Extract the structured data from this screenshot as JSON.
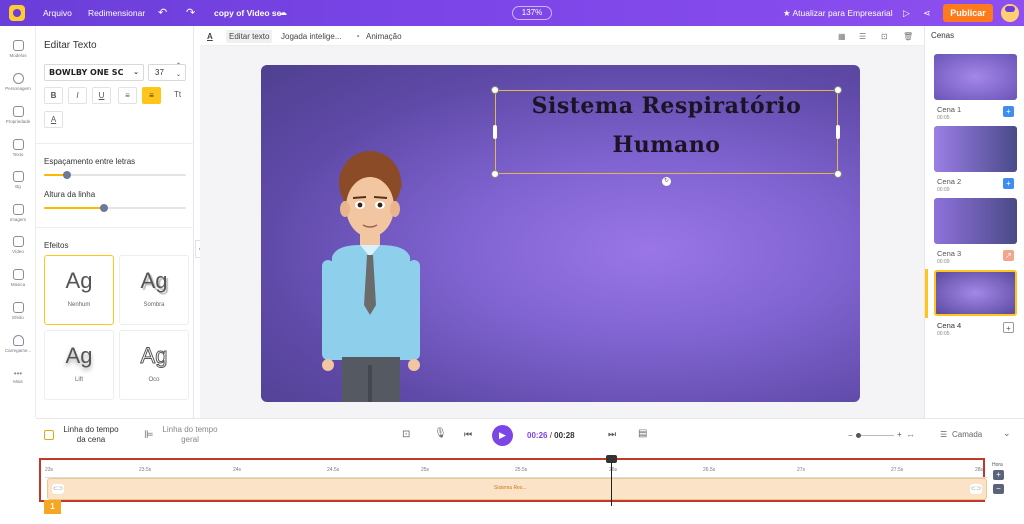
{
  "header": {
    "menu_arquivo": "Arquivo",
    "menu_redimensionar": "Redimensionar",
    "project_title": "copy of Video se",
    "zoom": "137%",
    "upgrade": "★ Atualizar para Empresarial",
    "publish": "Publicar"
  },
  "sidebar": {
    "items": [
      {
        "label": "Modelos",
        "icon": "templates-icon"
      },
      {
        "label": "Personagem",
        "icon": "character-icon"
      },
      {
        "label": "Propriedade",
        "icon": "props-icon"
      },
      {
        "label": "Texto",
        "icon": "text-icon"
      },
      {
        "label": "Bg",
        "icon": "background-icon"
      },
      {
        "label": "Imagem",
        "icon": "image-icon"
      },
      {
        "label": "Vídeo",
        "icon": "video-icon"
      },
      {
        "label": "Música",
        "icon": "music-icon"
      },
      {
        "label": "Efeito",
        "icon": "effect-icon"
      },
      {
        "label": "Carregame...",
        "icon": "upload-icon"
      },
      {
        "label": "Mais",
        "icon": "more-icon"
      }
    ]
  },
  "edit_panel": {
    "title": "Editar Texto",
    "font": "BOWLBY ONE SC",
    "size": "37",
    "bold": "B",
    "italic": "I",
    "underline": "U",
    "list": "≡",
    "align": "≡",
    "case": "Tt",
    "color": "A",
    "letter_spacing_label": "Espaçamento entre letras",
    "letter_spacing_value": 0.16,
    "line_height_label": "Altura da linha",
    "line_height_value": 0.42,
    "effects_label": "Efeitos",
    "effects": [
      {
        "preview": "Ag",
        "name": "Nenhum"
      },
      {
        "preview": "Ag",
        "name": "Sombra"
      },
      {
        "preview": "Ag",
        "name": "Lift"
      },
      {
        "preview": "Ag",
        "name": "Oco"
      }
    ]
  },
  "toolbar": {
    "edit_text": "Editar texto",
    "smart_move": "Jogada intelige...",
    "animation": "Animação"
  },
  "canvas": {
    "headline_line1": "Sistema Respiratório",
    "headline_line2": "Humano"
  },
  "scenes": {
    "title": "Cenas",
    "items": [
      {
        "name": "Cena 1",
        "time": "00:05"
      },
      {
        "name": "Cena 2",
        "time": "00:09"
      },
      {
        "name": "Cena 3",
        "time": "00:09"
      },
      {
        "name": "Cena 4",
        "time": "00:05"
      }
    ]
  },
  "bottombar": {
    "scene_timeline": "Linha do tempo da cena",
    "general_timeline": "Linha do tempo geral",
    "current_time": "00:26",
    "separator": " / ",
    "total_time": "00:28",
    "layer": "Camada"
  },
  "timeline": {
    "ticks": [
      "23s",
      "23.5s",
      "24s",
      "24.5s",
      "25s",
      "25.5s",
      "26s",
      "26.5s",
      "27s",
      "27.5s",
      "28s"
    ],
    "track_label": "Sistema Res...",
    "zoom_label": "Hora",
    "scene_number": "1"
  }
}
